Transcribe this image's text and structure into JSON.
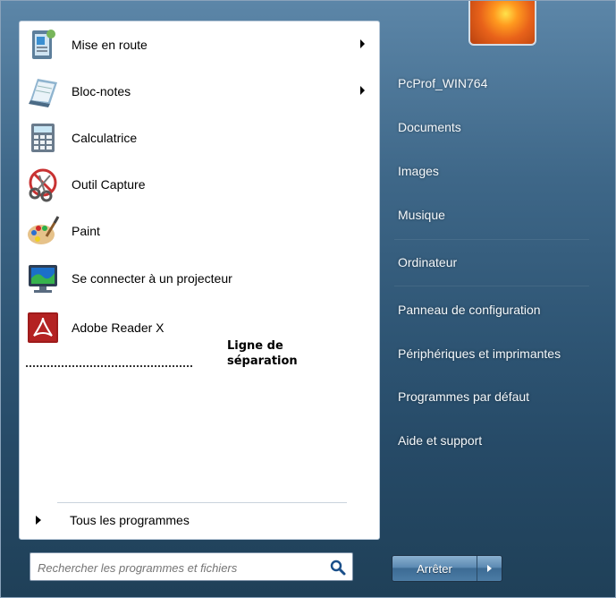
{
  "left_menu": {
    "items": [
      {
        "label": "Mise en route",
        "icon": "getting-started-icon",
        "has_arrow": true
      },
      {
        "label": "Bloc-notes",
        "icon": "notepad-icon",
        "has_arrow": true
      },
      {
        "label": "Calculatrice",
        "icon": "calculator-icon",
        "has_arrow": false
      },
      {
        "label": "Outil Capture",
        "icon": "snipping-tool-icon",
        "has_arrow": false
      },
      {
        "label": "Paint",
        "icon": "paint-palette-icon",
        "has_arrow": false
      },
      {
        "label": "Se connecter à un projecteur",
        "icon": "projector-monitor-icon",
        "has_arrow": false
      },
      {
        "label": "Adobe Reader X",
        "icon": "adobe-reader-icon",
        "has_arrow": false
      }
    ],
    "annotation_line1": "Ligne de",
    "annotation_line2": "séparation",
    "all_programs": "Tous les programmes"
  },
  "search": {
    "placeholder": "Rechercher les programmes et fichiers",
    "icon": "search-icon"
  },
  "right_menu": {
    "items": [
      "PcProf_WIN764",
      "Documents",
      "Images",
      "Musique",
      "Ordinateur",
      "Panneau de configuration",
      "Périphériques et imprimantes",
      "Programmes par défaut",
      "Aide et support"
    ]
  },
  "shutdown": {
    "label": "Arrêter"
  },
  "colors": {
    "panel_bg": "#ffffff",
    "right_bg": "#2f5675",
    "accent": "#ff9a1f"
  }
}
